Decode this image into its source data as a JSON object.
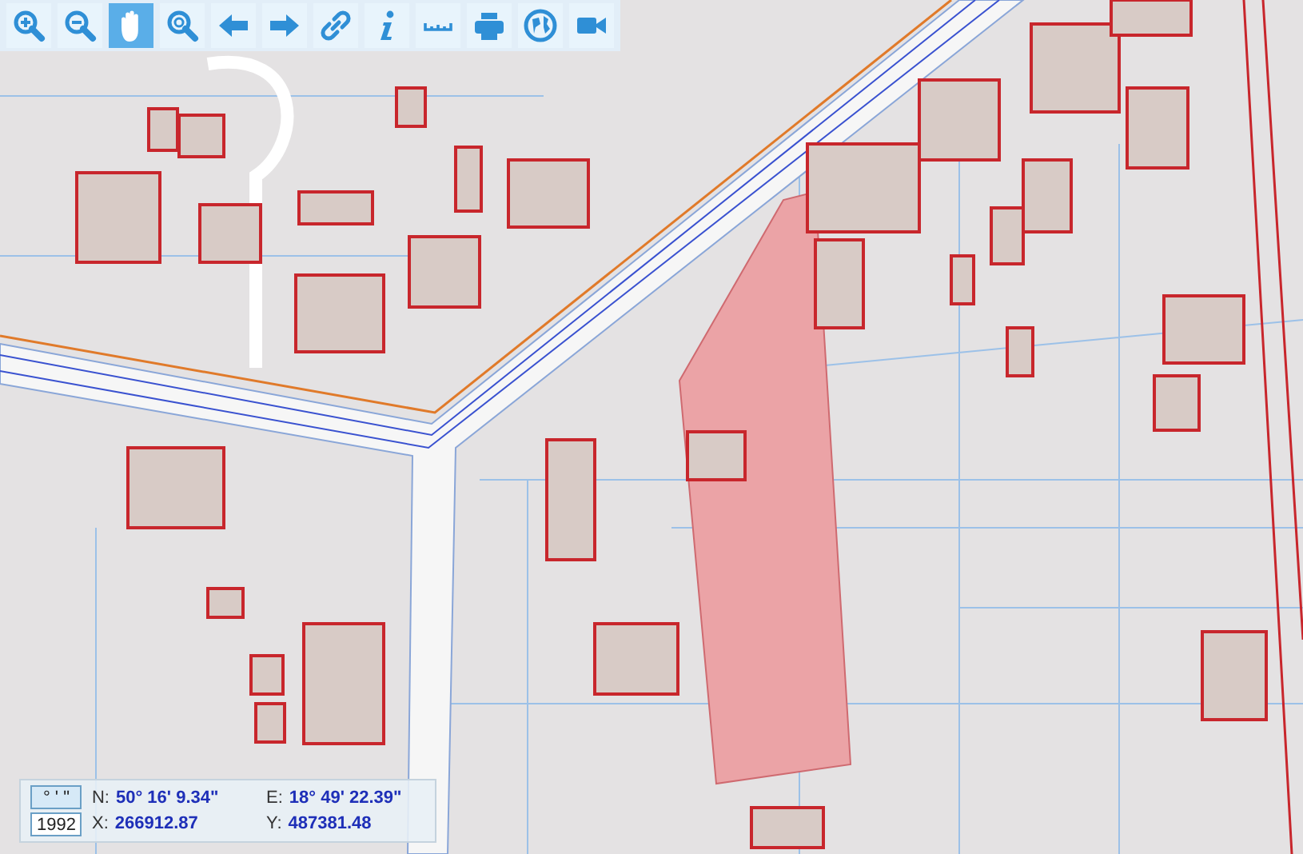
{
  "toolbar": {
    "buttons": [
      {
        "kind": "zoom-in",
        "selected": false
      },
      {
        "kind": "zoom-out",
        "selected": false
      },
      {
        "kind": "pan",
        "selected": true
      },
      {
        "kind": "zoom-extent",
        "selected": false
      },
      {
        "kind": "back",
        "selected": false
      },
      {
        "kind": "forward",
        "selected": false
      },
      {
        "kind": "link",
        "selected": false
      },
      {
        "kind": "info",
        "selected": false
      },
      {
        "kind": "measure",
        "selected": false
      },
      {
        "kind": "print",
        "selected": false
      },
      {
        "kind": "globe",
        "selected": false
      },
      {
        "kind": "video",
        "selected": false
      }
    ]
  },
  "coordinates": {
    "modes": [
      {
        "label": "° ' \"",
        "selected": true
      },
      {
        "label": "1992",
        "selected": false
      }
    ],
    "rows": [
      [
        {
          "label": "N:",
          "value": "50° 16' 9.34\""
        },
        {
          "label": "E:",
          "value": "18° 49' 22.39\""
        }
      ],
      [
        {
          "label": "X:",
          "value": "266912.87"
        },
        {
          "label": "Y:",
          "value": "487381.48"
        }
      ]
    ]
  }
}
